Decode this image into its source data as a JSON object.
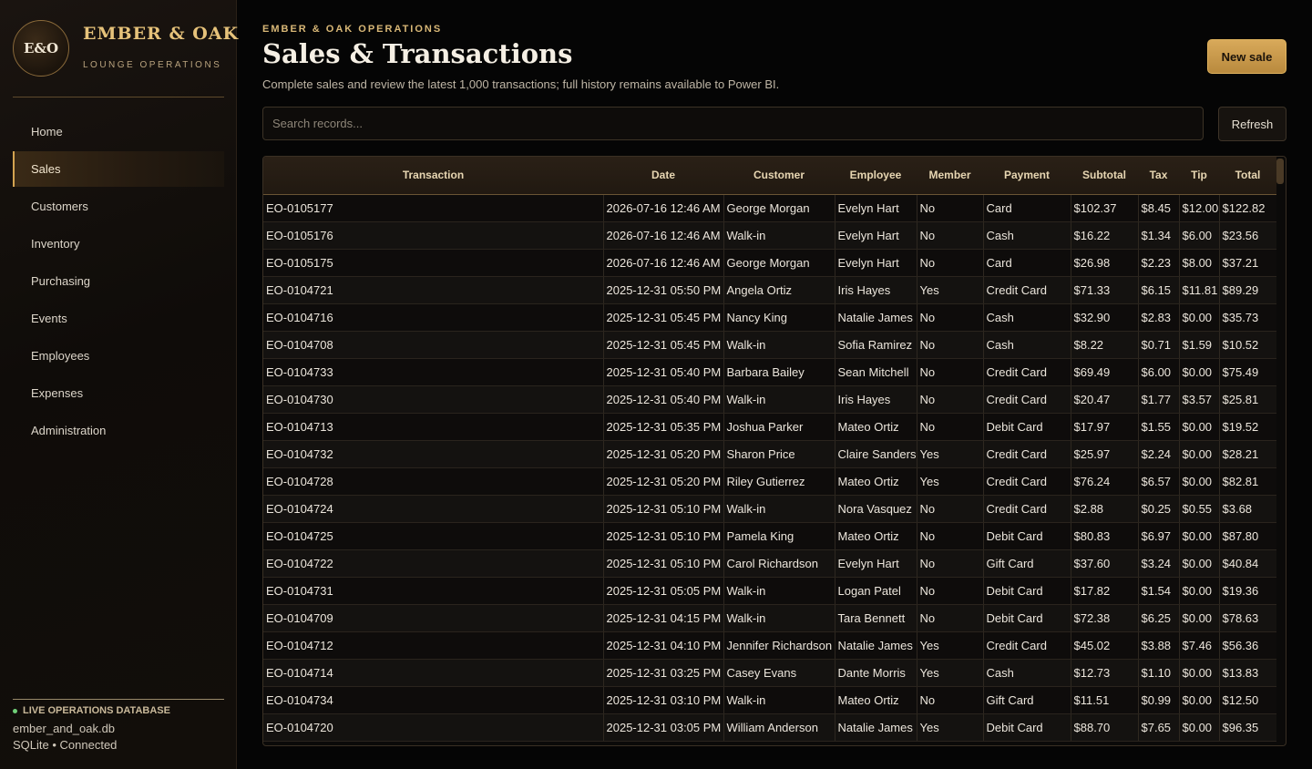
{
  "brand": {
    "logo": "E&O",
    "name": "EMBER & OAK",
    "subtitle": "LOUNGE OPERATIONS"
  },
  "nav": [
    {
      "label": "Home",
      "active": false
    },
    {
      "label": "Sales",
      "active": true
    },
    {
      "label": "Customers",
      "active": false
    },
    {
      "label": "Inventory",
      "active": false
    },
    {
      "label": "Purchasing",
      "active": false
    },
    {
      "label": "Events",
      "active": false
    },
    {
      "label": "Employees",
      "active": false
    },
    {
      "label": "Expenses",
      "active": false
    },
    {
      "label": "Administration",
      "active": false
    }
  ],
  "footer": {
    "status": "LIVE OPERATIONS DATABASE",
    "db_name": "ember_and_oak.db",
    "db_status": "SQLite • Connected"
  },
  "header": {
    "eyebrow": "EMBER & OAK OPERATIONS",
    "title": "Sales & Transactions",
    "description": "Complete sales and review the latest 1,000 transactions; full history remains available to Power BI.",
    "new_sale_label": "New sale"
  },
  "search": {
    "placeholder": "Search records...",
    "refresh_label": "Refresh"
  },
  "table": {
    "columns": [
      "Transaction",
      "Date",
      "Customer",
      "Employee",
      "Member",
      "Payment",
      "Subtotal",
      "Tax",
      "Tip",
      "Total"
    ],
    "rows": [
      [
        "EO-0105177",
        "2026-07-16 12:46 AM",
        "George Morgan",
        "Evelyn Hart",
        "No",
        "Card",
        "$102.37",
        "$8.45",
        "$12.00",
        "$122.82"
      ],
      [
        "EO-0105176",
        "2026-07-16 12:46 AM",
        "Walk-in",
        "Evelyn Hart",
        "No",
        "Cash",
        "$16.22",
        "$1.34",
        "$6.00",
        "$23.56"
      ],
      [
        "EO-0105175",
        "2026-07-16 12:46 AM",
        "George Morgan",
        "Evelyn Hart",
        "No",
        "Card",
        "$26.98",
        "$2.23",
        "$8.00",
        "$37.21"
      ],
      [
        "EO-0104721",
        "2025-12-31 05:50 PM",
        "Angela Ortiz",
        "Iris Hayes",
        "Yes",
        "Credit Card",
        "$71.33",
        "$6.15",
        "$11.81",
        "$89.29"
      ],
      [
        "EO-0104716",
        "2025-12-31 05:45 PM",
        "Nancy King",
        "Natalie James",
        "No",
        "Cash",
        "$32.90",
        "$2.83",
        "$0.00",
        "$35.73"
      ],
      [
        "EO-0104708",
        "2025-12-31 05:45 PM",
        "Walk-in",
        "Sofia Ramirez",
        "No",
        "Cash",
        "$8.22",
        "$0.71",
        "$1.59",
        "$10.52"
      ],
      [
        "EO-0104733",
        "2025-12-31 05:40 PM",
        "Barbara Bailey",
        "Sean Mitchell",
        "No",
        "Credit Card",
        "$69.49",
        "$6.00",
        "$0.00",
        "$75.49"
      ],
      [
        "EO-0104730",
        "2025-12-31 05:40 PM",
        "Walk-in",
        "Iris Hayes",
        "No",
        "Credit Card",
        "$20.47",
        "$1.77",
        "$3.57",
        "$25.81"
      ],
      [
        "EO-0104713",
        "2025-12-31 05:35 PM",
        "Joshua Parker",
        "Mateo Ortiz",
        "No",
        "Debit Card",
        "$17.97",
        "$1.55",
        "$0.00",
        "$19.52"
      ],
      [
        "EO-0104732",
        "2025-12-31 05:20 PM",
        "Sharon Price",
        "Claire Sanders",
        "Yes",
        "Credit Card",
        "$25.97",
        "$2.24",
        "$0.00",
        "$28.21"
      ],
      [
        "EO-0104728",
        "2025-12-31 05:20 PM",
        "Riley Gutierrez",
        "Mateo Ortiz",
        "Yes",
        "Credit Card",
        "$76.24",
        "$6.57",
        "$0.00",
        "$82.81"
      ],
      [
        "EO-0104724",
        "2025-12-31 05:10 PM",
        "Walk-in",
        "Nora Vasquez",
        "No",
        "Credit Card",
        "$2.88",
        "$0.25",
        "$0.55",
        "$3.68"
      ],
      [
        "EO-0104725",
        "2025-12-31 05:10 PM",
        "Pamela King",
        "Mateo Ortiz",
        "No",
        "Debit Card",
        "$80.83",
        "$6.97",
        "$0.00",
        "$87.80"
      ],
      [
        "EO-0104722",
        "2025-12-31 05:10 PM",
        "Carol Richardson",
        "Evelyn Hart",
        "No",
        "Gift Card",
        "$37.60",
        "$3.24",
        "$0.00",
        "$40.84"
      ],
      [
        "EO-0104731",
        "2025-12-31 05:05 PM",
        "Walk-in",
        "Logan Patel",
        "No",
        "Debit Card",
        "$17.82",
        "$1.54",
        "$0.00",
        "$19.36"
      ],
      [
        "EO-0104709",
        "2025-12-31 04:15 PM",
        "Walk-in",
        "Tara Bennett",
        "No",
        "Debit Card",
        "$72.38",
        "$6.25",
        "$0.00",
        "$78.63"
      ],
      [
        "EO-0104712",
        "2025-12-31 04:10 PM",
        "Jennifer Richardson",
        "Natalie James",
        "Yes",
        "Credit Card",
        "$45.02",
        "$3.88",
        "$7.46",
        "$56.36"
      ],
      [
        "EO-0104714",
        "2025-12-31 03:25 PM",
        "Casey Evans",
        "Dante Morris",
        "Yes",
        "Cash",
        "$12.73",
        "$1.10",
        "$0.00",
        "$13.83"
      ],
      [
        "EO-0104734",
        "2025-12-31 03:10 PM",
        "Walk-in",
        "Mateo Ortiz",
        "No",
        "Gift Card",
        "$11.51",
        "$0.99",
        "$0.00",
        "$12.50"
      ],
      [
        "EO-0104720",
        "2025-12-31 03:05 PM",
        "William Anderson",
        "Natalie James",
        "Yes",
        "Debit Card",
        "$88.70",
        "$7.65",
        "$0.00",
        "$96.35"
      ]
    ]
  }
}
